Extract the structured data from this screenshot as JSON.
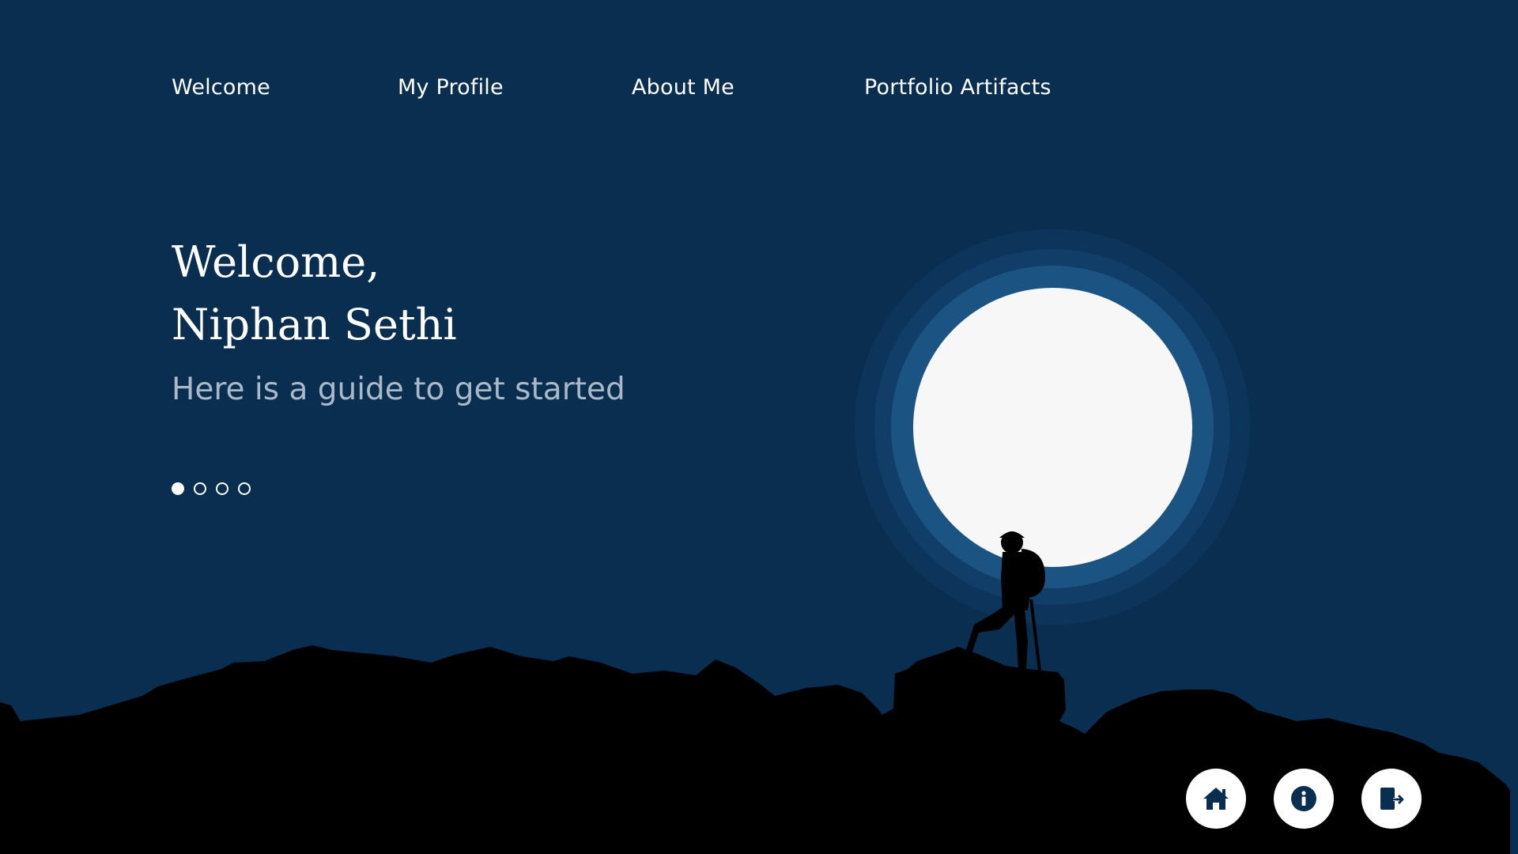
{
  "nav": {
    "items": [
      {
        "label": "Welcome"
      },
      {
        "label": "My Profile"
      },
      {
        "label": "About Me"
      },
      {
        "label": "Portfolio Artifacts"
      }
    ]
  },
  "hero": {
    "line1": "Welcome,",
    "line2": "Niphan Sethi",
    "subtitle": "Here is a guide to get started"
  },
  "pager": {
    "total": 4,
    "active_index": 0
  },
  "actions": [
    {
      "icon": "home-icon"
    },
    {
      "icon": "info-icon"
    },
    {
      "icon": "sign-out-icon"
    }
  ],
  "colors": {
    "background": "#0a2e50",
    "moon": "#f7f7f7",
    "moon_ring": "#1b5483",
    "text": "#ffffff",
    "subtitle": "#a9b9c9",
    "icon": "#0a2e50"
  }
}
